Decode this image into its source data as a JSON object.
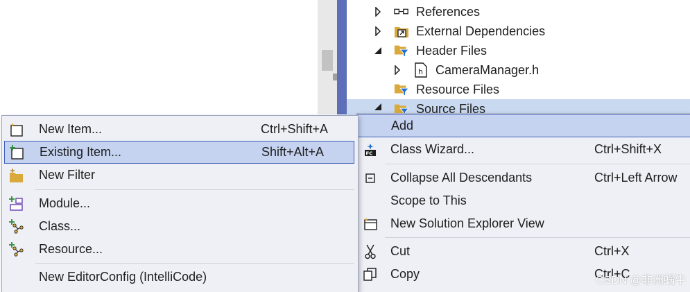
{
  "solution_explorer": {
    "items": [
      {
        "label": "References",
        "icon": "references-icon",
        "expander": "collapsed"
      },
      {
        "label": "External Dependencies",
        "icon": "external-dependencies-icon",
        "expander": "collapsed"
      },
      {
        "label": "Header Files",
        "icon": "filter-folder-icon",
        "expander": "expanded"
      },
      {
        "label": "CameraManager.h",
        "icon": "header-file-icon",
        "expander": "collapsed"
      },
      {
        "label": "Resource Files",
        "icon": "filter-folder-icon",
        "expander": "none"
      },
      {
        "label": "Source Files",
        "icon": "filter-folder-icon",
        "expander": "expanded",
        "selected": true
      }
    ]
  },
  "context_menu": {
    "items": [
      {
        "label": "Add",
        "shortcut": "",
        "icon": "",
        "highlighted": true,
        "submenu": true
      },
      {
        "label": "Class Wizard...",
        "shortcut": "Ctrl+Shift+X",
        "icon": "class-wizard-icon"
      },
      {
        "label": "Collapse All Descendants",
        "shortcut": "Ctrl+Left Arrow",
        "icon": "collapse-icon"
      },
      {
        "label": "Scope to This",
        "shortcut": "",
        "icon": ""
      },
      {
        "label": "New Solution Explorer View",
        "shortcut": "",
        "icon": "new-view-icon"
      },
      {
        "label": "Cut",
        "shortcut": "Ctrl+X",
        "icon": "scissors-icon"
      },
      {
        "label": "Copy",
        "shortcut": "Ctrl+C",
        "icon": "copy-icon"
      }
    ]
  },
  "add_submenu": {
    "items": [
      {
        "label": "New Item...",
        "shortcut": "Ctrl+Shift+A",
        "icon": "new-item-icon"
      },
      {
        "label": "Existing Item...",
        "shortcut": "Shift+Alt+A",
        "icon": "existing-item-icon",
        "highlighted": true
      },
      {
        "label": "New Filter",
        "shortcut": "",
        "icon": "new-filter-icon"
      },
      {
        "label": "Module...",
        "shortcut": "",
        "icon": "module-icon"
      },
      {
        "label": "Class...",
        "shortcut": "",
        "icon": "class-icon"
      },
      {
        "label": "Resource...",
        "shortcut": "",
        "icon": "resource-icon"
      },
      {
        "label": "New EditorConfig (IntelliCode)",
        "shortcut": "",
        "icon": ""
      }
    ]
  },
  "watermark": "CSDN @非洲蜗牛",
  "colors": {
    "menu_background": "#eef0f6",
    "highlight_fill": "#c5d3f1",
    "highlight_border": "#3d5fb8",
    "selected_row": "#c9d9f0",
    "splitter": "#5c6fb8",
    "filter_folder": "#d9a93c",
    "filter_funnel": "#1e6fd0"
  }
}
